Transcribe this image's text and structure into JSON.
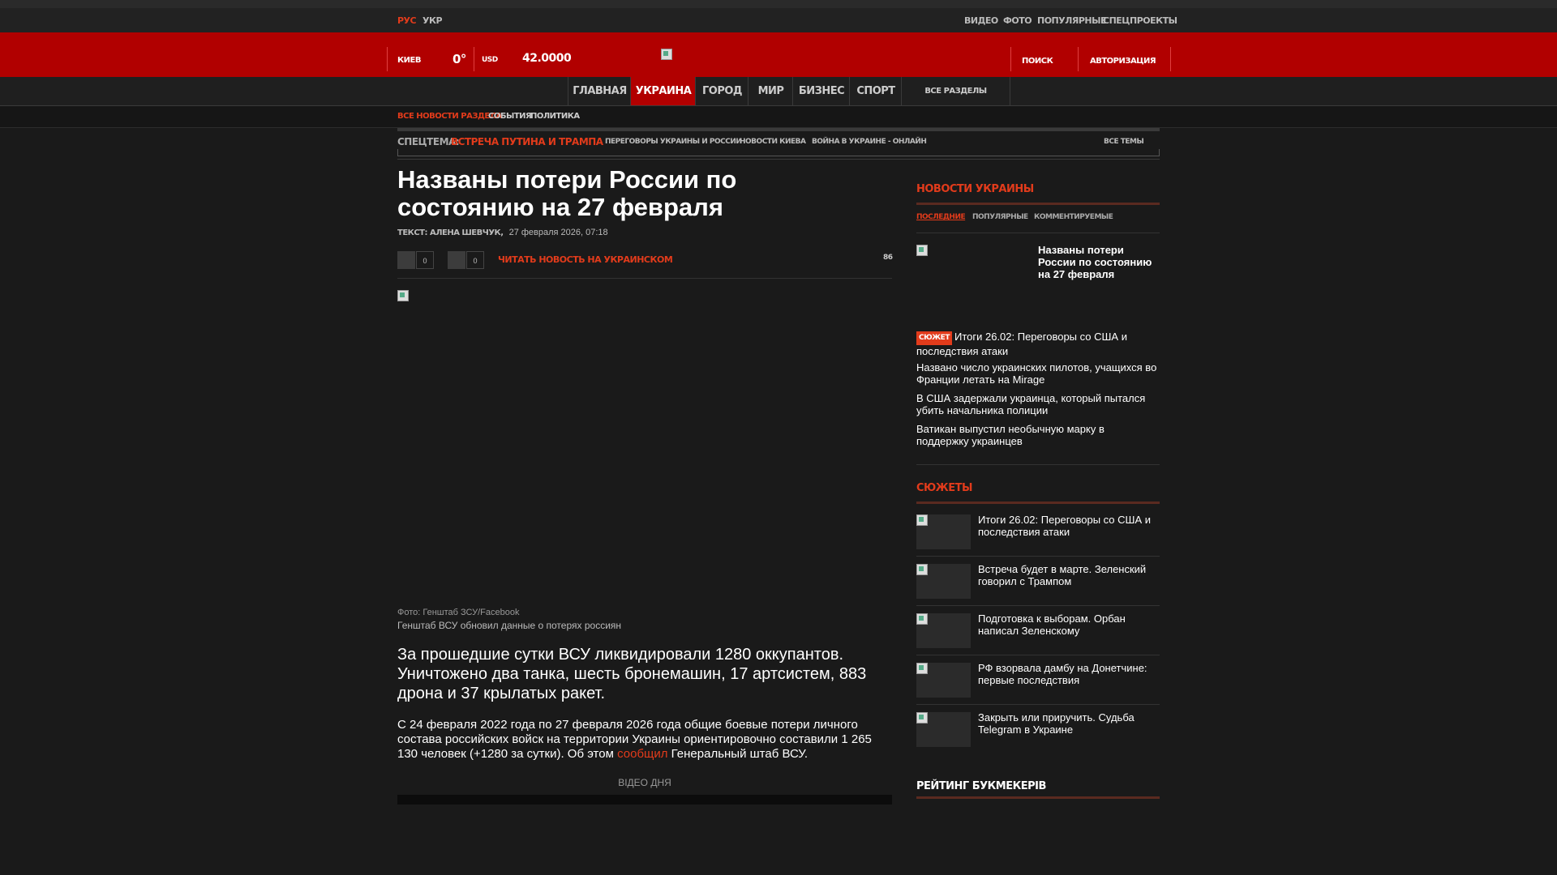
{
  "topbar": {
    "lang_ru": "РУС",
    "lang_ua": "УКР",
    "links": [
      "ВИДЕО",
      "ФОТО",
      "ПОПУЛЯРНЫЕ"
    ],
    "special_link": "СПЕЦПРОЕКТЫ"
  },
  "header": {
    "city": "КИЕВ",
    "temperature": "0°",
    "currency_label": "USD",
    "currency_value": "42.0000",
    "search": "ПОИСК",
    "login": "АВТОРИЗАЦИЯ"
  },
  "nav": {
    "items": [
      "ГЛАВНАЯ",
      "УКРАИНА",
      "ГОРОД",
      "МИР",
      "БИЗНЕС",
      "СПОРТ"
    ],
    "all_sections": "ВСЕ РАЗДЕЛЫ"
  },
  "subnav": {
    "all_news": "ВСЕ НОВОСТИ РАЗДЕЛА",
    "events": "СОБЫТИЯ",
    "politics": "ПОЛИТИКА"
  },
  "special_topic": {
    "label": "СПЕЦТЕМА:",
    "topic": "ВСТРЕЧА ПУТИНА И ТРАМПА",
    "links": [
      "ПЕРЕГОВОРЫ УКРАИНЫ И РОССИИ",
      "НОВОСТИ КИЕВА",
      "ВОЙНА В УКРАИНЕ - ОНЛАЙН"
    ],
    "all_topics": "ВСЕ ТЕМЫ"
  },
  "article": {
    "title": "Названы потери России по состоянию на 27 февраля",
    "author": "ТЕКСТ: АЛЕНА ШЕВЧУК,",
    "date": "27 февраля 2026, 07:18",
    "share_count_1": "0",
    "share_count_2": "0",
    "read_ukrainian": "ЧИТАТЬ НОВОСТЬ НА УКРАИНСКОМ",
    "views": "86",
    "photo_credit": "Фото: Генштаб ЗСУ/Facebook",
    "photo_caption": "Генштаб ВСУ обновил данные о потерях россиян",
    "lead": "За прошедшие сутки ВСУ ликвидировали 1280 оккупантов. Уничтожено два танка, шесть бронемашин, 17 артсистем, 883 дрона и 37 крылатых ракет.",
    "body_before": "С 24 февраля 2022 года по 27 февраля 2026 года общие боевые потери личного состава российских войск на территории Украины ориентировочно составили 1 265 130 человек (+1280 за сутки). Об этом ",
    "body_link": "сообщил",
    "body_after": " Генеральный штаб ВСУ.",
    "video_label": "ВІДЕО ДНЯ"
  },
  "sidebar": {
    "news_head": "НОВОСТИ УКРАИНЫ",
    "tabs": [
      "ПОСЛЕДНИЕ",
      "ПОПУЛЯРНЫЕ",
      "КОММЕНТИРУЕМЫЕ"
    ],
    "featured": "Названы потери России по состоянию на 27 февраля",
    "badge": "СЮЖЕТ",
    "news": [
      "Итоги 26.02: Переговоры со США и последствия атаки",
      "Названо число украинских пилотов, учащихся во Франции летать на Mirage",
      "В США задержали украинца, который пытался убить начальника полиции",
      "Ватикан выпустил необычную марку в поддержку украинцев"
    ],
    "stories_head": "СЮЖЕТЫ",
    "stories": [
      "Итоги 26.02: Переговоры со США и последствия атаки",
      "Встреча будет в марте. Зеленский говорил с Трампом",
      "Подготовка к выборам. Орбан написал Зеленскому",
      "РФ взорвала дамбу на Донетчине: первые последствия",
      "Закрыть или приручить. Судьба Telegram в Украине"
    ],
    "rating_head": "РЕЙТИНГ БУКМЕКЕРІВ"
  }
}
